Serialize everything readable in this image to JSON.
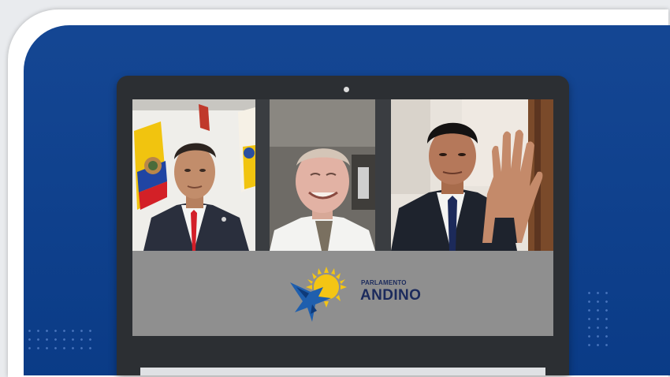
{
  "colors": {
    "panel_blue": "#0b3f8f",
    "laptop_frame": "#2c2f33",
    "logo_bar": "#8f8f8f",
    "logo_navy": "#1b2a5c",
    "logo_yellow": "#f4c514"
  },
  "video_call": {
    "participants": [
      {
        "id": "participant-1",
        "icon": "person-red-tie-flags"
      },
      {
        "id": "participant-2",
        "icon": "person-smiling"
      },
      {
        "id": "participant-3",
        "icon": "person-raised-hand"
      }
    ],
    "logo": {
      "line1": "PARLAMENTO",
      "line2": "ANDINO",
      "icon": "parlamento-andino-emblem-icon"
    }
  }
}
